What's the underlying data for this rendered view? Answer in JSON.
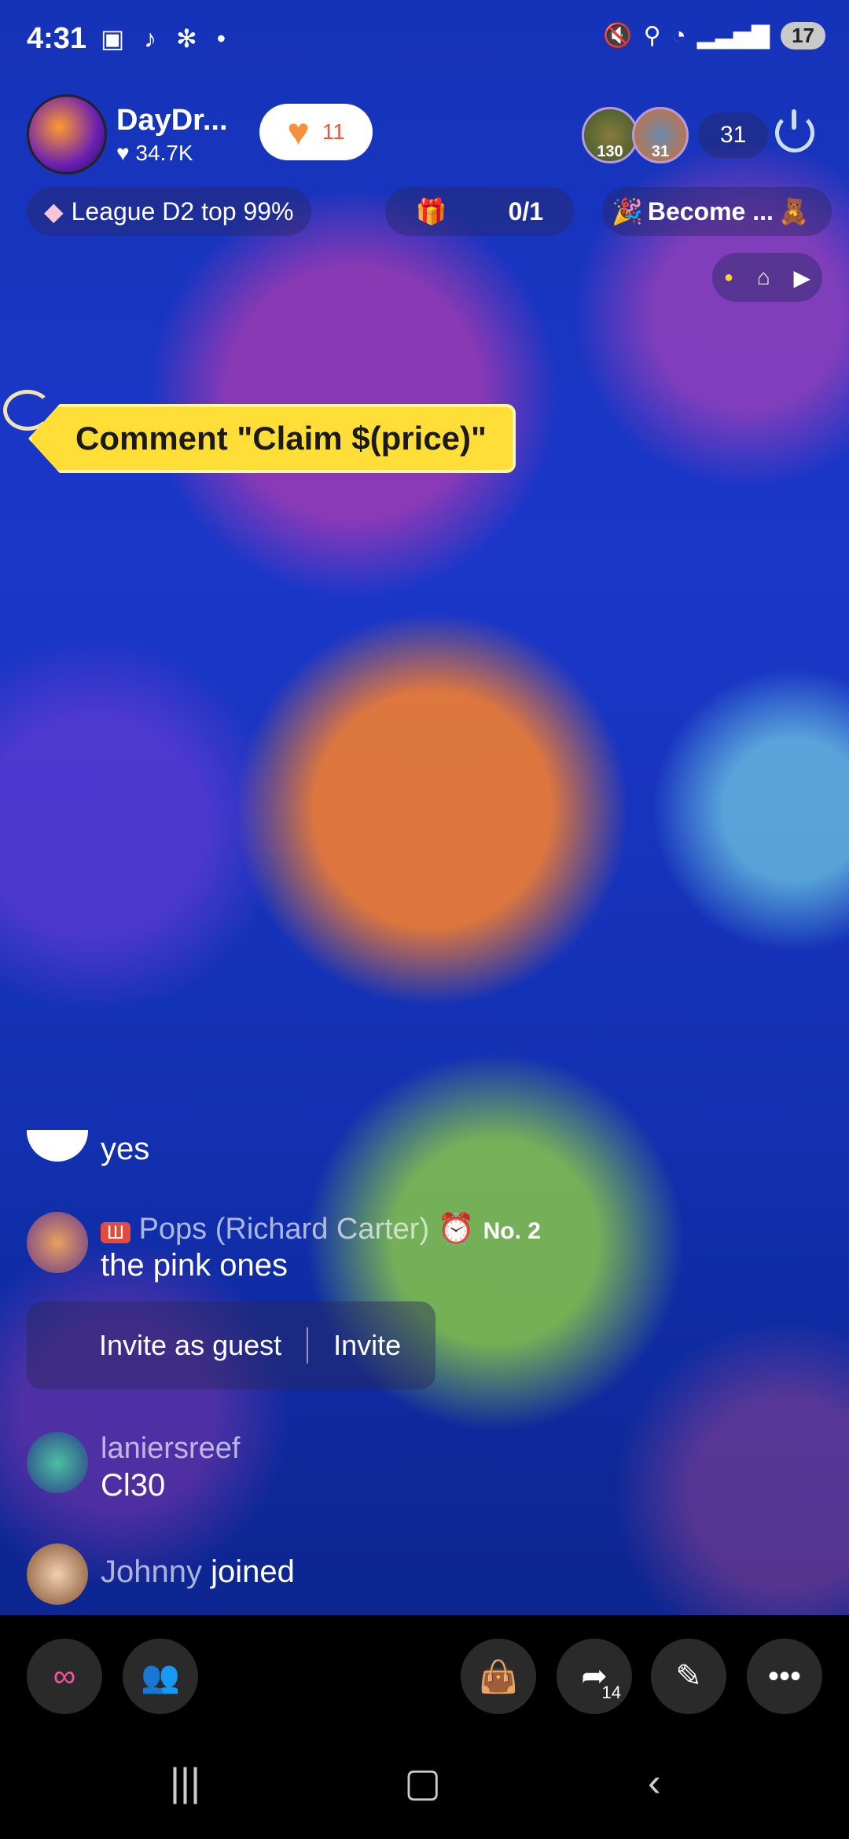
{
  "status_bar": {
    "time": "4:31",
    "battery": "17"
  },
  "host": {
    "name": "DayDr...",
    "likes": "34.7K",
    "follow_count": "11"
  },
  "viewers": {
    "badge1": "130",
    "badge2": "31",
    "count": "31"
  },
  "league": {
    "label": "League D2 top 99%"
  },
  "gift_goal": {
    "progress": "0/1"
  },
  "become": {
    "label": "Become ..."
  },
  "claim_banner": {
    "text": "Comment \"Claim $(price)\""
  },
  "chat": [
    {
      "user": "",
      "text": "yes"
    },
    {
      "user": "Pops (Richard Carter)",
      "badge": "No. 2",
      "text": "the pink ones"
    },
    {
      "user": "laniersreef",
      "text": "Cl30"
    },
    {
      "user": "Johnny",
      "text": "joined"
    }
  ],
  "invite": {
    "guest": "Invite as guest",
    "invite": "Invite"
  },
  "toolbar": {
    "share_count": "14"
  },
  "icons": [
    "heart-icon",
    "diamond-icon",
    "gift-icon",
    "power-icon",
    "link-icon",
    "people-icon",
    "bag-icon",
    "share-icon",
    "magic-wand-icon",
    "more-icon",
    "recent-apps-icon",
    "home-icon",
    "back-icon"
  ],
  "colors": {
    "claim_yellow": "#ffde37",
    "follow_heart": "#f5913d"
  }
}
